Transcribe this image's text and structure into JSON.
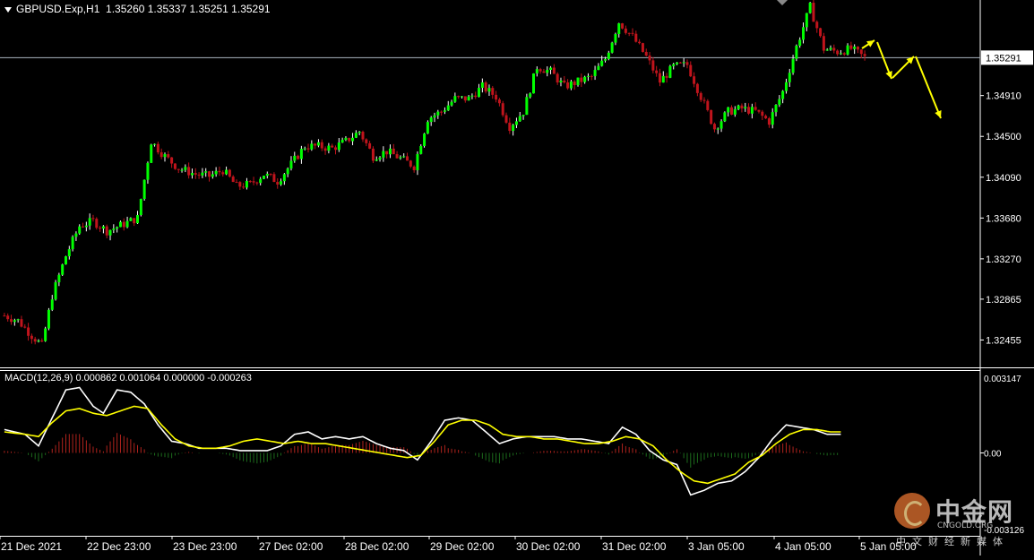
{
  "header": {
    "symbol": "GBPUSD.Exp,H1",
    "ohlc": "1.35260 1.35337 1.35251 1.35291"
  },
  "macd_label": "MACD(12,26,9) 0.000862 0.001064 0.000000 -0.000263",
  "current_price": "1.35291",
  "watermark": {
    "title": "中金网",
    "sub": "CNGOLD.ORG",
    "tagline": "中文财经新媒体"
  },
  "colors": {
    "bull": "#00ff00",
    "bear": "#c0141c",
    "bull_wick": "#ffffff",
    "macd_main": "#ffffff",
    "macd_signal": "#ffff00",
    "hist_pos": "#b0231d",
    "hist_neg": "#1c6b1c",
    "arrow": "#ffff00",
    "grid": "#ffffff"
  },
  "chart_data": [
    {
      "type": "candlestick",
      "title": "GBPUSD.Exp,H1",
      "y_ticks": [
        "1.35291",
        "1.34910",
        "1.34500",
        "1.34090",
        "1.33680",
        "1.33270",
        "1.32865",
        "1.32455"
      ],
      "ylim": [
        1.3218,
        1.3587
      ],
      "x_ticks": [
        "21 Dec 2021",
        "22 Dec 23:00",
        "23 Dec 23:00",
        "27 Dec 02:00",
        "28 Dec 02:00",
        "29 Dec 02:00",
        "30 Dec 02:00",
        "31 Dec 02:00",
        "3 Jan 05:00",
        "4 Jan 05:00",
        "5 Jan 05:00"
      ],
      "close_path": [
        [
          0,
          1.327
        ],
        [
          4,
          1.3265
        ],
        [
          8,
          1.325
        ],
        [
          11,
          1.324
        ],
        [
          14,
          1.329
        ],
        [
          18,
          1.333
        ],
        [
          22,
          1.336
        ],
        [
          26,
          1.3365
        ],
        [
          30,
          1.3355
        ],
        [
          35,
          1.3362
        ],
        [
          39,
          1.3368
        ],
        [
          43,
          1.3445
        ],
        [
          47,
          1.343
        ],
        [
          51,
          1.3418
        ],
        [
          56,
          1.3412
        ],
        [
          60,
          1.341
        ],
        [
          64,
          1.3416
        ],
        [
          68,
          1.34
        ],
        [
          72,
          1.3402
        ],
        [
          76,
          1.3412
        ],
        [
          80,
          1.3405
        ],
        [
          84,
          1.3422
        ],
        [
          88,
          1.344
        ],
        [
          92,
          1.344
        ],
        [
          96,
          1.3438
        ],
        [
          100,
          1.3445
        ],
        [
          104,
          1.3455
        ],
        [
          108,
          1.343
        ],
        [
          112,
          1.3435
        ],
        [
          116,
          1.3428
        ],
        [
          120,
          1.342
        ],
        [
          124,
          1.3468
        ],
        [
          128,
          1.3475
        ],
        [
          132,
          1.3488
        ],
        [
          136,
          1.3488
        ],
        [
          140,
          1.35
        ],
        [
          144,
          1.349
        ],
        [
          148,
          1.346
        ],
        [
          152,
          1.3475
        ],
        [
          156,
          1.352
        ],
        [
          160,
          1.3515
        ],
        [
          164,
          1.35
        ],
        [
          168,
          1.3505
        ],
        [
          172,
          1.351
        ],
        [
          176,
          1.3528
        ],
        [
          180,
          1.3565
        ],
        [
          184,
          1.355
        ],
        [
          188,
          1.353
        ],
        [
          192,
          1.3505
        ],
        [
          196,
          1.352
        ],
        [
          200,
          1.3522
        ],
        [
          204,
          1.349
        ],
        [
          208,
          1.3458
        ],
        [
          212,
          1.3475
        ],
        [
          216,
          1.3478
        ],
        [
          220,
          1.3475
        ],
        [
          224,
          1.3465
        ],
        [
          228,
          1.3495
        ],
        [
          232,
          1.354
        ],
        [
          236,
          1.358
        ],
        [
          240,
          1.3538
        ],
        [
          244,
          1.3535
        ],
        [
          248,
          1.3538
        ],
        [
          252,
          1.3529
        ]
      ],
      "series": [
        {
          "name": "MACD(12,26,9)",
          "axis_ticks": [
            "0.003147",
            "0.00",
            "-0.003126"
          ],
          "ylim": [
            -0.00355,
            0.00355
          ]
        }
      ],
      "macd_main": [
        [
          0,
          0.001
        ],
        [
          6,
          0.0008
        ],
        [
          10,
          0.0003
        ],
        [
          14,
          0.0015
        ],
        [
          18,
          0.0027
        ],
        [
          22,
          0.0028
        ],
        [
          26,
          0.002
        ],
        [
          29,
          0.0017
        ],
        [
          33,
          0.0027
        ],
        [
          37,
          0.0026
        ],
        [
          41,
          0.0021
        ],
        [
          45,
          0.0012
        ],
        [
          49,
          0.0005
        ],
        [
          53,
          0.0004
        ],
        [
          57,
          0.0002
        ],
        [
          61,
          0.0002
        ],
        [
          65,
          0.0002
        ],
        [
          69,
          0.0001
        ],
        [
          73,
          0.0001
        ],
        [
          77,
          0.0001
        ],
        [
          81,
          0.0003
        ],
        [
          85,
          0.0008
        ],
        [
          89,
          0.0009
        ],
        [
          93,
          0.0006
        ],
        [
          97,
          0.0007
        ],
        [
          101,
          0.0006
        ],
        [
          105,
          0.0007
        ],
        [
          109,
          0.0004
        ],
        [
          113,
          0.0002
        ],
        [
          117,
          0.0001
        ],
        [
          121,
          -0.0003
        ],
        [
          125,
          0.0005
        ],
        [
          129,
          0.0014
        ],
        [
          133,
          0.0015
        ],
        [
          137,
          0.0014
        ],
        [
          141,
          0.0009
        ],
        [
          145,
          0.0004
        ],
        [
          149,
          0.0006
        ],
        [
          153,
          0.0007
        ],
        [
          157,
          0.0007
        ],
        [
          161,
          0.0007
        ],
        [
          165,
          0.0006
        ],
        [
          169,
          0.0006
        ],
        [
          173,
          0.0005
        ],
        [
          177,
          0.0004
        ],
        [
          181,
          0.0011
        ],
        [
          185,
          0.0008
        ],
        [
          189,
          0.0001
        ],
        [
          193,
          -0.0003
        ],
        [
          197,
          -0.0005
        ],
        [
          201,
          -0.0018
        ],
        [
          205,
          -0.0016
        ],
        [
          209,
          -0.0013
        ],
        [
          213,
          -0.0012
        ],
        [
          217,
          -0.0008
        ],
        [
          221,
          -0.0002
        ],
        [
          225,
          0.0006
        ],
        [
          229,
          0.0012
        ],
        [
          233,
          0.0011
        ],
        [
          237,
          0.001
        ],
        [
          241,
          0.0008
        ],
        [
          245,
          0.0008
        ]
      ],
      "macd_signal": [
        [
          0,
          0.0009
        ],
        [
          6,
          0.0008
        ],
        [
          10,
          0.0007
        ],
        [
          14,
          0.0013
        ],
        [
          18,
          0.0018
        ],
        [
          22,
          0.0019
        ],
        [
          26,
          0.0017
        ],
        [
          30,
          0.0016
        ],
        [
          34,
          0.0018
        ],
        [
          38,
          0.002
        ],
        [
          42,
          0.0019
        ],
        [
          46,
          0.0012
        ],
        [
          50,
          0.0006
        ],
        [
          54,
          0.0003
        ],
        [
          58,
          0.0002
        ],
        [
          62,
          0.0002
        ],
        [
          66,
          0.0003
        ],
        [
          70,
          0.0005
        ],
        [
          74,
          0.0006
        ],
        [
          78,
          0.0005
        ],
        [
          82,
          0.0004
        ],
        [
          86,
          0.0005
        ],
        [
          90,
          0.0004
        ],
        [
          94,
          0.0004
        ],
        [
          98,
          0.0003
        ],
        [
          102,
          0.0002
        ],
        [
          106,
          0.0001
        ],
        [
          110,
          0.0
        ],
        [
          114,
          -0.0001
        ],
        [
          118,
          -0.0002
        ],
        [
          122,
          -0.0001
        ],
        [
          126,
          0.0005
        ],
        [
          130,
          0.0012
        ],
        [
          134,
          0.0014
        ],
        [
          138,
          0.0014
        ],
        [
          142,
          0.0012
        ],
        [
          146,
          0.0008
        ],
        [
          150,
          0.0007
        ],
        [
          154,
          0.0007
        ],
        [
          158,
          0.0006
        ],
        [
          162,
          0.0006
        ],
        [
          166,
          0.0005
        ],
        [
          170,
          0.0004
        ],
        [
          174,
          0.0004
        ],
        [
          178,
          0.0005
        ],
        [
          182,
          0.0007
        ],
        [
          186,
          0.0006
        ],
        [
          190,
          0.0003
        ],
        [
          194,
          -0.0003
        ],
        [
          198,
          -0.0008
        ],
        [
          202,
          -0.0012
        ],
        [
          206,
          -0.0013
        ],
        [
          210,
          -0.0011
        ],
        [
          214,
          -0.0009
        ],
        [
          218,
          -0.0004
        ],
        [
          222,
          -0.0001
        ],
        [
          226,
          0.0004
        ],
        [
          230,
          0.0008
        ],
        [
          234,
          0.001
        ],
        [
          238,
          0.001
        ],
        [
          242,
          0.0009
        ],
        [
          245,
          0.0009
        ]
      ],
      "bars_count": 253
    }
  ]
}
